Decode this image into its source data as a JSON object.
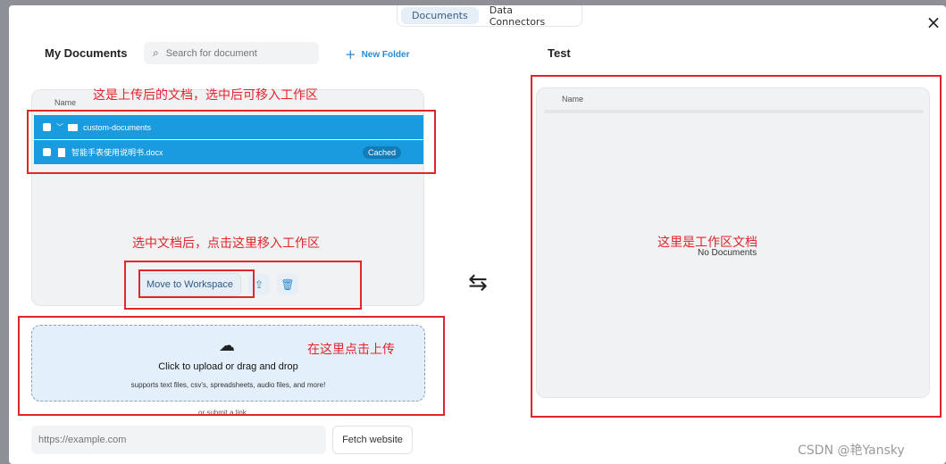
{
  "tabs": [
    "Documents",
    "Data Connectors"
  ],
  "close_icon": "×",
  "left_title": "My Documents",
  "search_placeholder": "Search for document",
  "new_folder_label": "New Folder",
  "right_title": "Test",
  "table": {
    "name_header": "Name",
    "rows": [
      {
        "label": "custom-documents",
        "type": "folder"
      },
      {
        "label": "智能手表使用说明书.docx",
        "type": "file",
        "badge": "Cached"
      }
    ]
  },
  "move_button": "Move to Workspace",
  "swap_icon": "⇆",
  "upload": {
    "title": "Click to upload or drag and drop",
    "subtitle": "supports text files, csv's, spreadsheets, audio files, and more!"
  },
  "submit_link_text": "or submit a link",
  "url_placeholder": "https://example.com",
  "fetch_button": "Fetch website",
  "workspace": {
    "name_header": "Name",
    "empty_text": "No Documents"
  },
  "annotations": {
    "a1": "这是上传后的文档，选中后可移入工作区",
    "a2": "选中文档后，点击这里移入工作区",
    "a3": "在这里点击上传",
    "a4": "这里是工作区文档"
  },
  "watermark": "CSDN @艳Yansky",
  "colors": {
    "accent": "#1a9be0",
    "annotation": "#e0262b"
  }
}
